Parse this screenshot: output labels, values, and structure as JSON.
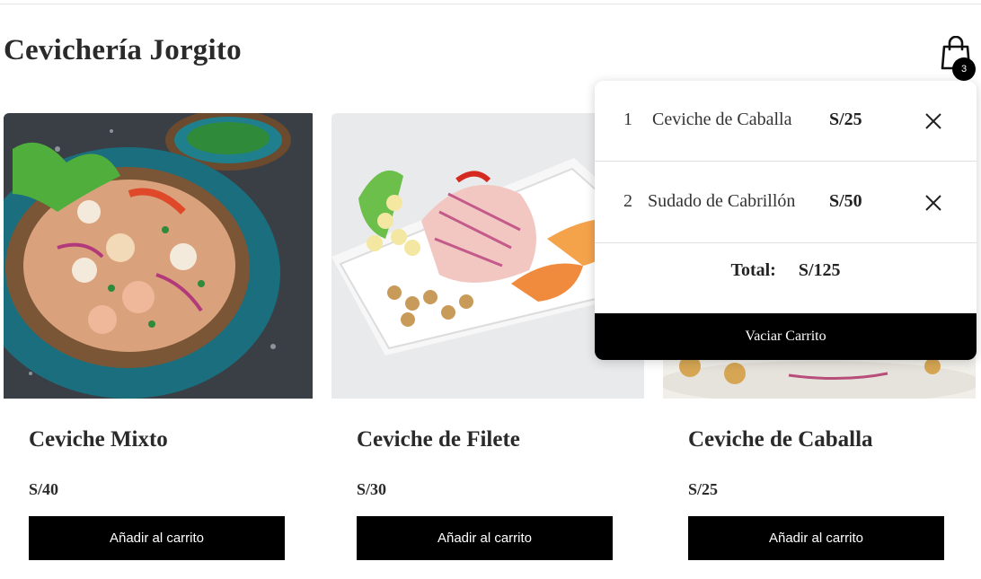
{
  "header": {
    "brand": "Cevichería Jorgito",
    "cart_count": "3"
  },
  "products": [
    {
      "name": "Ceviche Mixto",
      "price": "S/40",
      "button": "Añadir al carrito"
    },
    {
      "name": "Ceviche de Filete",
      "price": "S/30",
      "button": "Añadir al carrito"
    },
    {
      "name": "Ceviche de Caballa",
      "price": "S/25",
      "button": "Añadir al carrito"
    }
  ],
  "cart": {
    "items": [
      {
        "qty": "1",
        "name": "Ceviche de Caballa",
        "price": "S/25"
      },
      {
        "qty": "2",
        "name": "Sudado de Cabrillón",
        "price": "S/50"
      }
    ],
    "total_label": "Total:",
    "total_value": "S/125",
    "clear_label": "Vaciar Carrito"
  },
  "icons": {
    "cart": "shopping-bag-icon",
    "remove": "close-icon"
  },
  "colors": {
    "button_bg": "#000000",
    "button_text": "#ffffff",
    "text": "#2a2a2a"
  }
}
